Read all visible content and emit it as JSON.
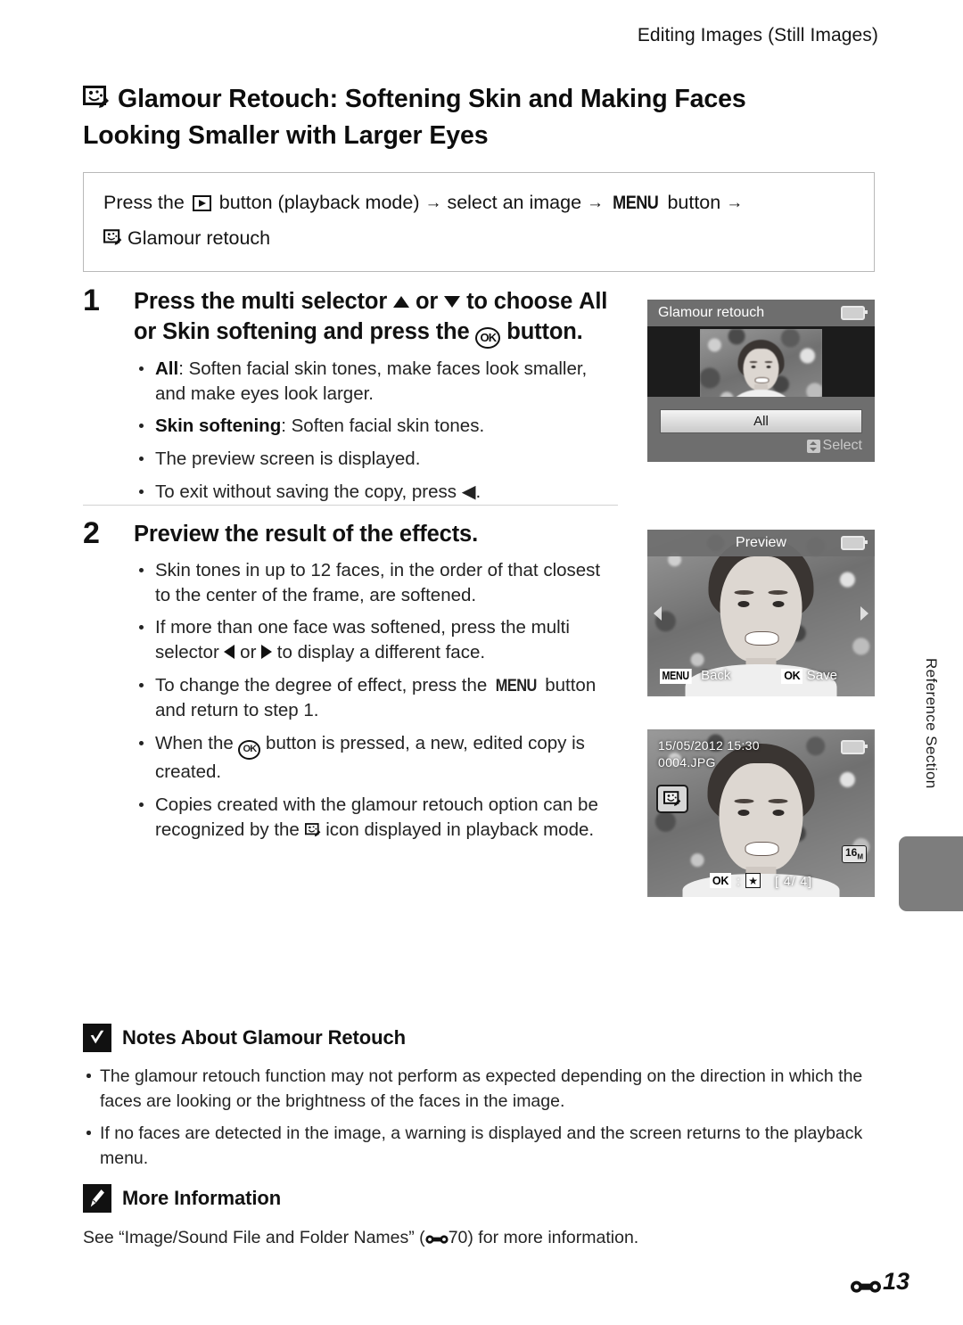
{
  "header": {
    "running_head": "Editing Images (Still Images)"
  },
  "title": {
    "icon": "glamour-retouch-icon",
    "line1": "Glamour Retouch: Softening Skin and Making Faces",
    "line2": "Looking Smaller with Larger Eyes"
  },
  "path_box": {
    "seg1": "Press the",
    "playback_icon": "playback-button-icon",
    "seg2": "button (playback mode)",
    "arrow": "→",
    "seg3": "select an image",
    "menu_label": "MENU",
    "seg4": "button",
    "seg5": "Glamour retouch"
  },
  "steps": [
    {
      "number": "1",
      "heading_a": "Press the multi selector",
      "heading_up": "▲",
      "heading_b": "or",
      "heading_dn": "▼",
      "heading_c": "to choose",
      "heading_all": "All",
      "heading_d": "or",
      "heading_skin": "Skin softening",
      "heading_e": "and press the",
      "heading_ok": "OK",
      "heading_f": "button.",
      "bullets": [
        {
          "lead": "All",
          "text": ": Soften facial skin tones, make faces look smaller, and make eyes look larger."
        },
        {
          "lead": "Skin softening",
          "text": ": Soften facial skin tones."
        },
        {
          "lead": "",
          "text": "The preview screen is displayed."
        },
        {
          "lead": "",
          "text": "To exit without saving the copy, press ◀."
        }
      ]
    },
    {
      "number": "2",
      "heading": "Preview the result of the effects.",
      "bullets": [
        {
          "text": "Skin tones in up to 12 faces, in the order of that closest to the center of the frame, are softened."
        },
        {
          "text": "If more than one face was softened, press the multi selector ◀ or ▶ to display a different face."
        },
        {
          "text": "To change the degree of effect, press the MENU button and return to step 1."
        },
        {
          "text": "When the OK button is pressed, a new, edited copy is created."
        },
        {
          "text": "Copies created with the glamour retouch option can be recognized by the icon displayed in playback mode."
        }
      ]
    }
  ],
  "screens": {
    "menu": {
      "title": "Glamour retouch",
      "battery_icon": "battery-icon",
      "selected_option": "All",
      "hint_icon": "up-down-select-icon",
      "hint_label": "Select"
    },
    "preview": {
      "title": "Preview",
      "battery_icon": "battery-icon",
      "left_arrow_icon": "left-arrow-icon",
      "right_arrow_icon": "right-arrow-icon",
      "menu_chip": "MENU",
      "menu_label": "Back",
      "ok_chip": "OK",
      "ok_label": "Save"
    },
    "playback": {
      "datetime": "15/05/2012 15:30",
      "filename": "0004.JPG",
      "retouch_badge_icon": "glamour-retouch-badge-icon",
      "image_size": "16",
      "image_size_unit": "M",
      "ok_chip": "OK",
      "ok_separator": ":",
      "star_icon": "★",
      "frame_counter": "[    4/    4]",
      "battery_icon": "battery-icon"
    }
  },
  "side_tab": {
    "label": "Reference Section"
  },
  "notes": {
    "icon": "caution-check-icon",
    "title": "Notes About Glamour Retouch",
    "bullets": [
      "The glamour retouch function may not perform as expected depending on the direction in which the faces are looking or the brightness of the faces in the image.",
      "If no faces are detected in the image, a warning is displayed and the screen returns to the playback menu."
    ]
  },
  "more_info": {
    "icon": "pencil-icon",
    "title": "More Information",
    "text_before": "See “Image/Sound File and Folder Names” (",
    "ref_icon": "reference-section-icon",
    "ref_page": "70",
    "text_after": ") for more information."
  },
  "footer": {
    "ref_icon": "reference-section-icon",
    "page_number": "13"
  }
}
